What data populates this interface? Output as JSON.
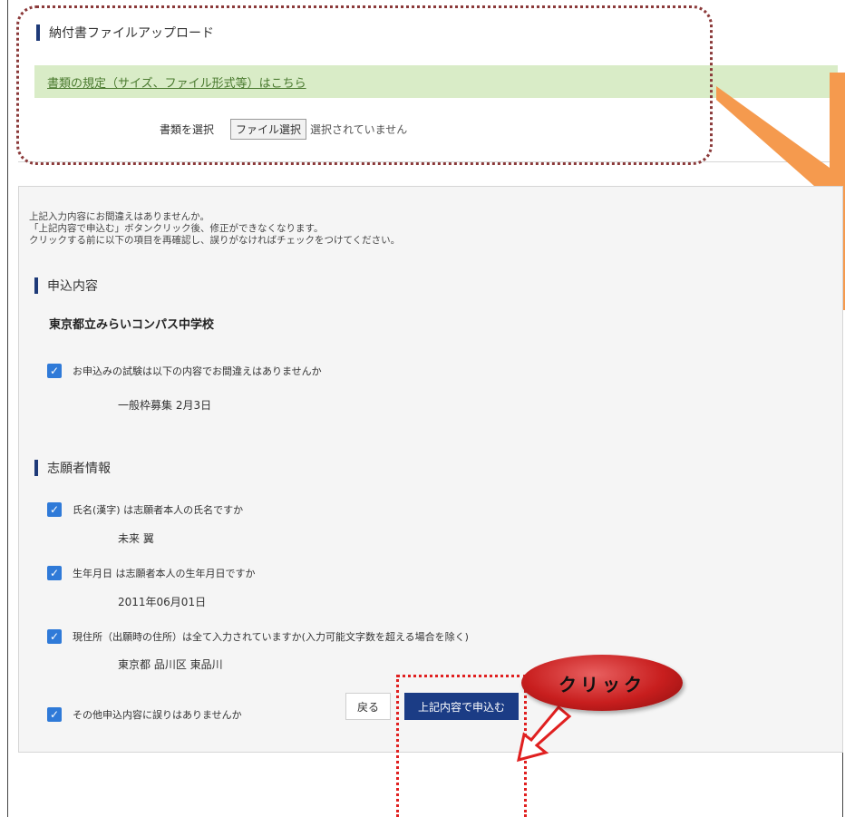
{
  "upload": {
    "heading": "納付書ファイルアップロード",
    "guide_link": "書類の規定（サイズ、ファイル形式等）はこちら",
    "select_label": "書類を選択",
    "file_button": "ファイル選択",
    "file_status": "選択されていません"
  },
  "confirm": {
    "notice": [
      "上記入力内容にお間違えはありませんか。",
      "「上記内容で申込む」ボタンクリック後、修正ができなくなります。",
      "クリックする前に以下の項目を再確認し、誤りがなければチェックをつけてください。"
    ],
    "section_application": "申込内容",
    "school_name": "東京都立みらいコンパス中学校",
    "exam_check": "お申込みの試験は以下の内容でお間違えはありませんか",
    "exam_value": "一般枠募集 2月3日",
    "section_applicant": "志願者情報",
    "name_check": "氏名(漢字) は志願者本人の氏名ですか",
    "name_value": "未来 翼",
    "birth_check": "生年月日 は志願者本人の生年月日ですか",
    "birth_value": "2011年06月01日",
    "address_check": "現住所（出願時の住所）は全て入力されていますか(入力可能文字数を超える場合を除く)",
    "address_value": "東京都 品川区 東品川",
    "other_check": "その他申込内容に誤りはありませんか"
  },
  "buttons": {
    "back": "戻る",
    "submit": "上記内容で申込む"
  },
  "callout": {
    "click_label": "クリック"
  },
  "colors": {
    "accent_navy": "#1b3c85",
    "checkbox_blue": "#2f7ad8",
    "guide_green": "#d9ecc7",
    "callout_red": "#c81e1e",
    "arrow_orange": "#f59a4e"
  }
}
